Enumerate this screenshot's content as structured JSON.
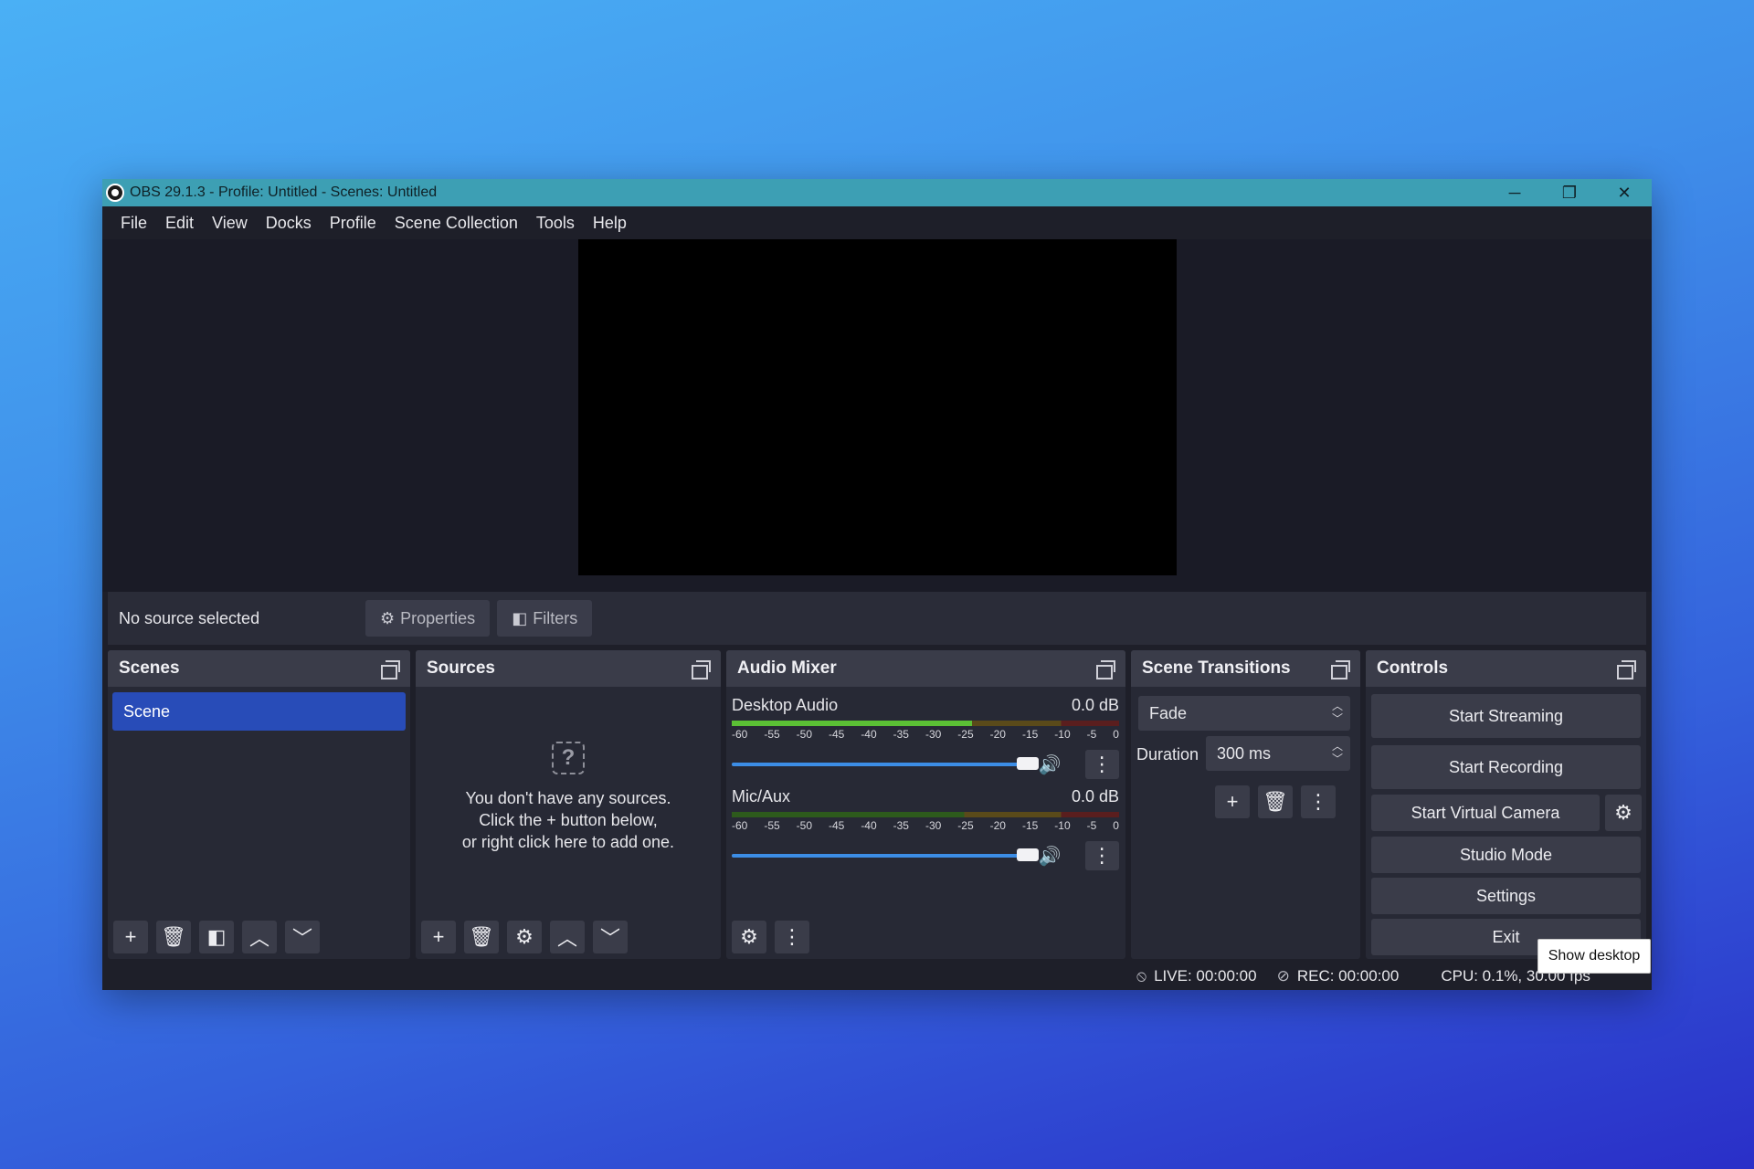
{
  "window": {
    "title": "OBS 29.1.3 - Profile: Untitled - Scenes: Untitled",
    "controls": {
      "minimize": "─",
      "maximize": "❐",
      "close": "✕"
    }
  },
  "menu": [
    "File",
    "Edit",
    "View",
    "Docks",
    "Profile",
    "Scene Collection",
    "Tools",
    "Help"
  ],
  "source_bar": {
    "status": "No source selected",
    "properties_label": "Properties",
    "filters_label": "Filters"
  },
  "scenes": {
    "title": "Scenes",
    "items": [
      "Scene"
    ],
    "icons": [
      "plus-icon",
      "trash-icon",
      "filter-icon",
      "chevron-up-icon",
      "chevron-down-icon"
    ]
  },
  "sources": {
    "title": "Sources",
    "empty_lines": [
      "You don't have any sources.",
      "Click the + button below,",
      "or right click here to add one."
    ],
    "empty_icon_glyph": "?",
    "icons": [
      "plus-icon",
      "trash-icon",
      "gear-icon",
      "chevron-up-icon",
      "chevron-down-icon"
    ]
  },
  "audio_mixer": {
    "title": "Audio Mixer",
    "ticks": [
      "-60",
      "-55",
      "-50",
      "-45",
      "-40",
      "-35",
      "-30",
      "-25",
      "-20",
      "-15",
      "-10",
      "-5",
      "0"
    ],
    "channels": [
      {
        "name": "Desktop Audio",
        "level": "0.0 dB",
        "meter_fill": 0.62,
        "volume": 1.0
      },
      {
        "name": "Mic/Aux",
        "level": "0.0 dB",
        "meter_fill": 0.0,
        "volume": 1.0
      }
    ],
    "icons": [
      "gear-icon",
      "kebab-icon"
    ]
  },
  "transitions": {
    "title": "Scene Transitions",
    "selected": "Fade",
    "duration_label": "Duration",
    "duration_value": "300 ms",
    "icons": [
      "plus-icon",
      "trash-icon",
      "kebab-icon"
    ]
  },
  "controls": {
    "title": "Controls",
    "start_streaming": "Start Streaming",
    "start_recording": "Start Recording",
    "start_virtual_camera": "Start Virtual Camera",
    "studio_mode": "Studio Mode",
    "settings": "Settings",
    "exit": "Exit"
  },
  "status": {
    "live": "LIVE: 00:00:00",
    "rec": "REC: 00:00:00",
    "cpu": "CPU: 0.1%, 30.00 fps"
  },
  "tooltip": "Show desktop",
  "colors": {
    "accent": "#284cb8",
    "titlebar": "#3d9fb4",
    "meter_green": "#5bc035",
    "slider_blue": "#3c8de6"
  }
}
